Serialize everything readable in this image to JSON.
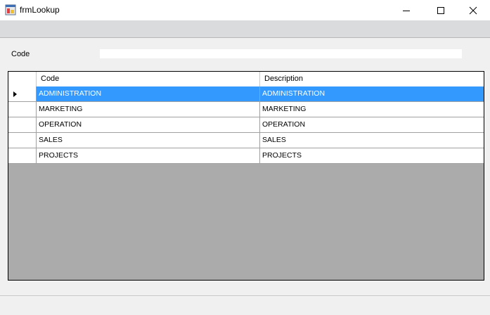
{
  "window": {
    "title": "frmLookup",
    "icon": "app-form-icon",
    "controls": [
      "minimize-icon",
      "maximize-icon",
      "close-icon"
    ]
  },
  "form": {
    "code_label": "Code",
    "code_value": "",
    "code_placeholder": ""
  },
  "grid": {
    "columns": [
      "Code",
      "Description"
    ],
    "rows": [
      {
        "code": "ADMINISTRATION",
        "description": "ADMINISTRATION",
        "selected": true
      },
      {
        "code": "MARKETING",
        "description": "MARKETING",
        "selected": false
      },
      {
        "code": "OPERATION",
        "description": "OPERATION",
        "selected": false
      },
      {
        "code": "SALES",
        "description": "SALES",
        "selected": false
      },
      {
        "code": "PROJECTS",
        "description": "PROJECTS",
        "selected": false
      }
    ],
    "colors": {
      "selection": "#3399ff",
      "empty_area": "#ababab"
    }
  }
}
